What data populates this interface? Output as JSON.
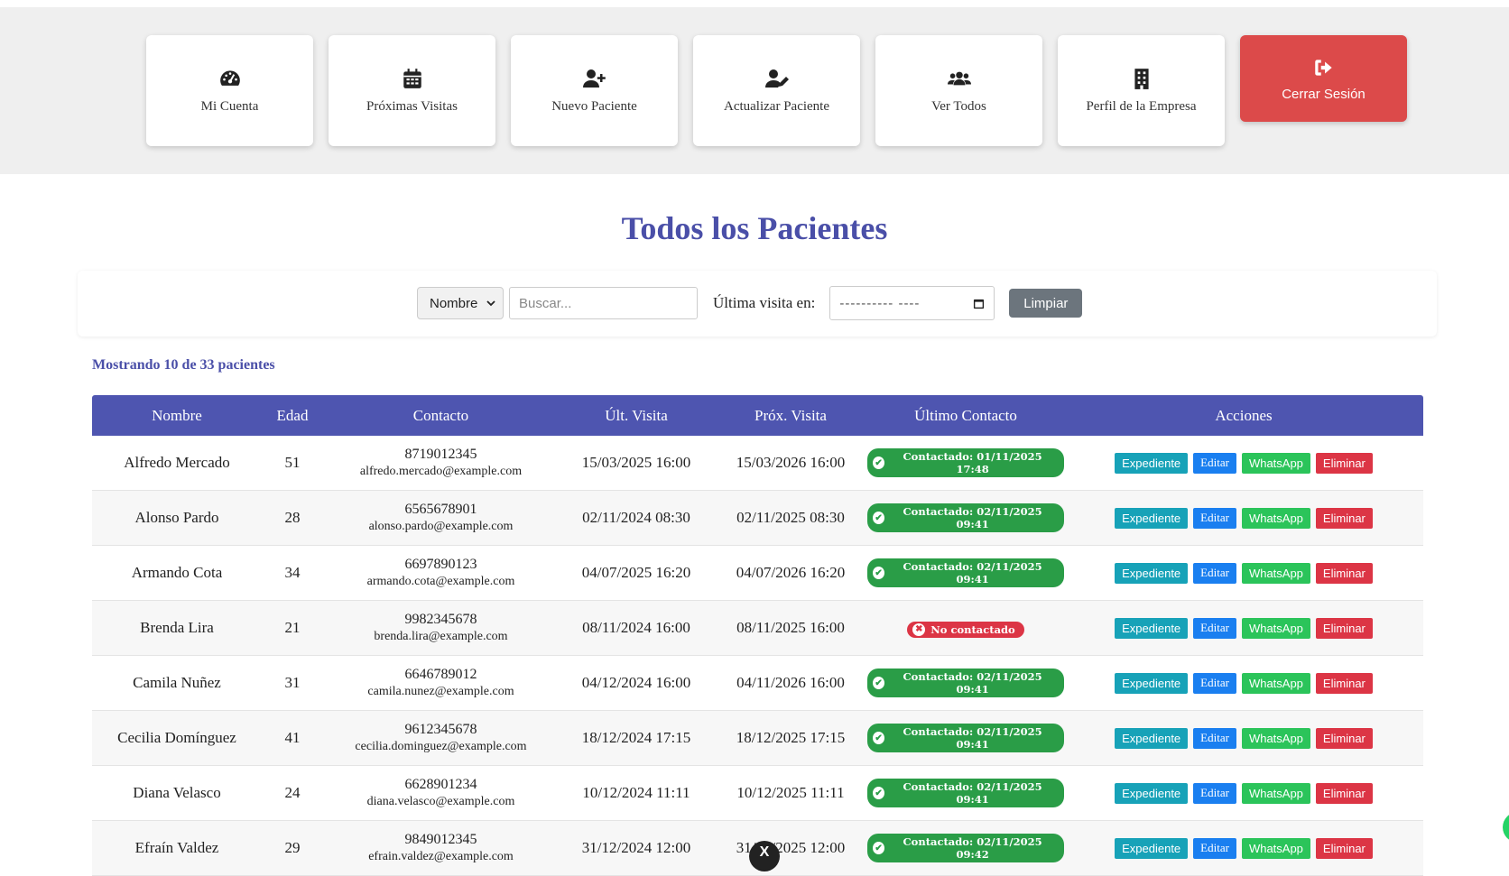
{
  "nav": {
    "items": [
      {
        "label": "Mi Cuenta",
        "icon": "dashboard-icon"
      },
      {
        "label": "Próximas Visitas",
        "icon": "calendar-icon"
      },
      {
        "label": "Nuevo Paciente",
        "icon": "user-plus-icon"
      },
      {
        "label": "Actualizar Paciente",
        "icon": "user-edit-icon"
      },
      {
        "label": "Ver Todos",
        "icon": "users-icon"
      },
      {
        "label": "Perfil de la Empresa",
        "icon": "building-icon"
      }
    ],
    "logout": {
      "label": "Cerrar Sesión",
      "icon": "sign-out-icon",
      "color": "#dc4a4a"
    }
  },
  "page": {
    "title": "Todos los Pacientes",
    "accent": "#4a4fa8"
  },
  "filters": {
    "field_select": "Nombre",
    "search_placeholder": "Buscar...",
    "date_label": "Última visita en:",
    "date_value": "---------- ----",
    "clear_label": "Limpiar"
  },
  "count_text": "Mostrando 10 de 33 pacientes",
  "table": {
    "headers": [
      "Nombre",
      "Edad",
      "Contacto",
      "Últ. Visita",
      "Próx. Visita",
      "Último Contacto",
      "Acciones"
    ],
    "actions": {
      "exp": "Expediente",
      "edit": "Editar",
      "wa": "WhatsApp",
      "del": "Eliminar"
    },
    "rows": [
      {
        "name": "Alfredo Mercado",
        "age": "51",
        "phone": "8719012345",
        "email": "alfredo.mercado@example.com",
        "last": "15/03/2025 16:00",
        "next": "15/03/2026 16:00",
        "status": "ok",
        "contact": "Contactado: 01/11/2025 17:48"
      },
      {
        "name": "Alonso Pardo",
        "age": "28",
        "phone": "6565678901",
        "email": "alonso.pardo@example.com",
        "last": "02/11/2024 08:30",
        "next": "02/11/2025 08:30",
        "status": "ok",
        "contact": "Contactado: 02/11/2025 09:41"
      },
      {
        "name": "Armando Cota",
        "age": "34",
        "phone": "6697890123",
        "email": "armando.cota@example.com",
        "last": "04/07/2025 16:20",
        "next": "04/07/2026 16:20",
        "status": "ok",
        "contact": "Contactado: 02/11/2025 09:41"
      },
      {
        "name": "Brenda Lira",
        "age": "21",
        "phone": "9982345678",
        "email": "brenda.lira@example.com",
        "last": "08/11/2024 16:00",
        "next": "08/11/2025 16:00",
        "status": "no",
        "contact": "No contactado"
      },
      {
        "name": "Camila Nuñez",
        "age": "31",
        "phone": "6646789012",
        "email": "camila.nunez@example.com",
        "last": "04/12/2024 16:00",
        "next": "04/11/2026 16:00",
        "status": "ok",
        "contact": "Contactado: 02/11/2025 09:41"
      },
      {
        "name": "Cecilia Domínguez",
        "age": "41",
        "phone": "9612345678",
        "email": "cecilia.dominguez@example.com",
        "last": "18/12/2024 17:15",
        "next": "18/12/2025 17:15",
        "status": "ok",
        "contact": "Contactado: 02/11/2025 09:41"
      },
      {
        "name": "Diana Velasco",
        "age": "24",
        "phone": "6628901234",
        "email": "diana.velasco@example.com",
        "last": "10/12/2024 11:11",
        "next": "10/12/2025 11:11",
        "status": "ok",
        "contact": "Contactado: 02/11/2025 09:41"
      },
      {
        "name": "Efraín Valdez",
        "age": "29",
        "phone": "9849012345",
        "email": "efrain.valdez@example.com",
        "last": "31/12/2024 12:00",
        "next": "31/12/2025 12:00",
        "status": "ok",
        "contact": "Contactado: 02/11/2025 09:42"
      }
    ]
  },
  "overlay": {
    "close_glyph": "X"
  }
}
